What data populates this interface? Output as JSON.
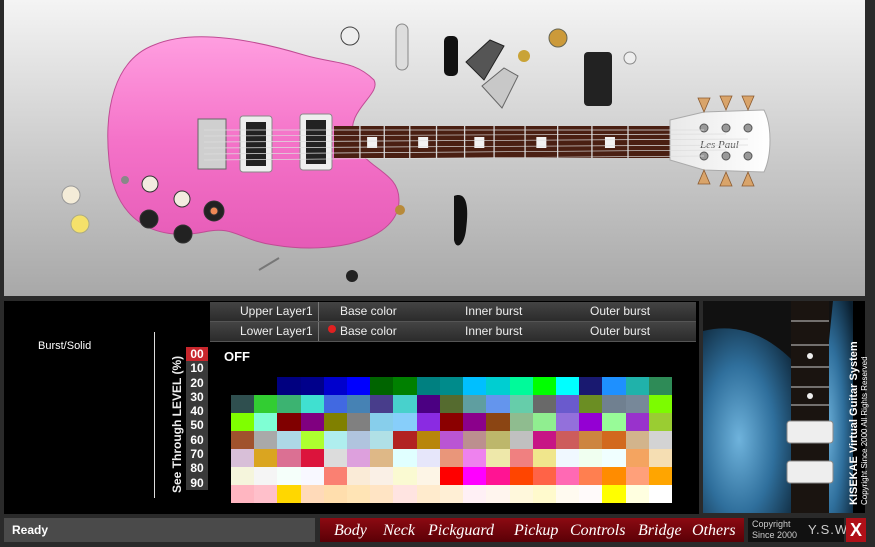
{
  "panel": {
    "burst_label": "Burst/Solid",
    "see_through_label": "See Through LEVEL (%)",
    "levels": [
      "00",
      "10",
      "20",
      "30",
      "40",
      "50",
      "60",
      "70",
      "80",
      "90"
    ],
    "selected_level": "00",
    "off_label": "OFF",
    "upper_layer": {
      "label": "Upper Layer1",
      "base": "Base color",
      "inner": "Inner burst",
      "outer": "Outer burst"
    },
    "lower_layer": {
      "label": "Lower Layer1",
      "base": "Base color",
      "inner": "Inner burst",
      "outer": "Outer burst"
    },
    "palette": [
      [
        "#000000",
        "#000000",
        "#000080",
        "#00008b",
        "#0000cd",
        "#0000ff",
        "#006400",
        "#008000",
        "#008080",
        "#008b8b",
        "#00bfff",
        "#00ced1",
        "#00fa9a",
        "#00ff00",
        "#00ffff",
        "#191970",
        "#1e90ff",
        "#20b2aa",
        "#2e8b57"
      ],
      [
        "#2f4f4f",
        "#32cd32",
        "#3cb371",
        "#40e0d0",
        "#4169e1",
        "#4682b4",
        "#483d8b",
        "#48d1cc",
        "#4b0082",
        "#556b2f",
        "#5f9ea0",
        "#6495ed",
        "#66cdaa",
        "#696969",
        "#6a5acd",
        "#6b8e23",
        "#708090",
        "#778899",
        "#7cfc00"
      ],
      [
        "#7fff00",
        "#7fffd4",
        "#800000",
        "#800080",
        "#808000",
        "#808080",
        "#87ceeb",
        "#87cefa",
        "#8a2be2",
        "#8b0000",
        "#8b008b",
        "#8b4513",
        "#8fbc8f",
        "#90ee90",
        "#9370db",
        "#9400d3",
        "#98fb98",
        "#9932cc",
        "#9acd32"
      ],
      [
        "#a0522d",
        "#a9a9a9",
        "#add8e6",
        "#adff2f",
        "#afeeee",
        "#b0c4de",
        "#b0e0e6",
        "#b22222",
        "#b8860b",
        "#ba55d3",
        "#bc8f8f",
        "#bdb76b",
        "#c0c0c0",
        "#c71585",
        "#cd5c5c",
        "#cd853f",
        "#d2691e",
        "#d2b48c",
        "#d3d3d3"
      ],
      [
        "#d8bfd8",
        "#daa520",
        "#db7093",
        "#dc143c",
        "#dcdcdc",
        "#dda0dd",
        "#deb887",
        "#e0ffff",
        "#e6e6fa",
        "#e9967a",
        "#ee82ee",
        "#eee8aa",
        "#f08080",
        "#f0e68c",
        "#f0f8ff",
        "#f0fff0",
        "#f0ffff",
        "#f4a460",
        "#f5deb3"
      ],
      [
        "#f5f5dc",
        "#f5f5f5",
        "#f5fffa",
        "#f8f8ff",
        "#fa8072",
        "#faebd7",
        "#faf0e6",
        "#fafad2",
        "#fdf5e6",
        "#ff0000",
        "#ff00ff",
        "#ff1493",
        "#ff4500",
        "#ff6347",
        "#ff69b4",
        "#ff7f50",
        "#ff8c00",
        "#ffa07a",
        "#ffa500"
      ],
      [
        "#ffb6c1",
        "#ffc0cb",
        "#ffd700",
        "#ffdab9",
        "#ffdead",
        "#ffe4b5",
        "#ffe4c4",
        "#ffe4e1",
        "#ffebcd",
        "#ffefd5",
        "#fff0f5",
        "#fff5ee",
        "#fff8dc",
        "#fffacd",
        "#fffaf0",
        "#fffafa",
        "#ffff00",
        "#ffffe0",
        "#ffffff"
      ]
    ]
  },
  "status": {
    "text": "Ready"
  },
  "menu": [
    "Body",
    "Neck",
    "Pickguard",
    "Pickup",
    "Controls",
    "Bridge",
    "Others"
  ],
  "copyright": {
    "line1": "Copyright",
    "line2": "Since 2000",
    "brand": "Y.S.W",
    "close": "X"
  },
  "preview": {
    "title": "KISEKAE Virtual Guitar System",
    "copyright": "Copyright Since 2000 All Rights Reserved"
  },
  "guitar": {
    "body_color": "#f472c8",
    "headstock_text": "Les Paul"
  },
  "colors": {
    "accent": "#c8262c",
    "menu_bg": "#8c0a12"
  }
}
